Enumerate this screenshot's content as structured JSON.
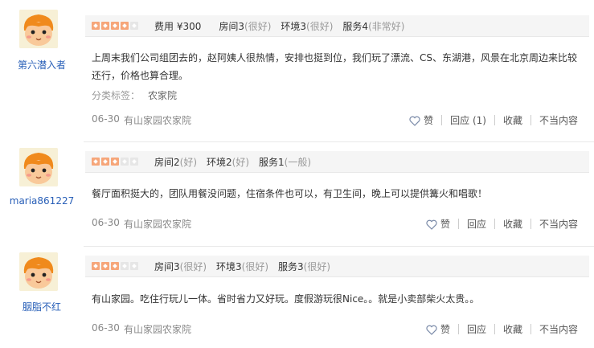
{
  "reviews": [
    {
      "username": "第六潜入者",
      "stars": 4,
      "price_label": "费用",
      "price_value": "¥300",
      "scores": [
        {
          "name": "房间3",
          "level": "(很好)"
        },
        {
          "name": "环境3",
          "level": "(很好)"
        },
        {
          "name": "服务4",
          "level": "(非常好)"
        }
      ],
      "content": "上周末我们公司组团去的，赵阿姨人很热情，安排也挺到位，我们玩了漂流、CS、东湖港，风景在北京周边来比较还行，价格也算合理。",
      "tags_label": "分类标签：",
      "tag": "农家院",
      "date": "06-30",
      "shop": "有山家园农家院",
      "like_label": "赞",
      "reply_label": "回应",
      "reply_count": "(1)",
      "collect_label": "收藏",
      "report_label": "不当内容"
    },
    {
      "username": "maria861227",
      "stars": 3,
      "scores": [
        {
          "name": "房间2",
          "level": "(好)"
        },
        {
          "name": "环境2",
          "level": "(好)"
        },
        {
          "name": "服务1",
          "level": "(一般)"
        }
      ],
      "content": "餐厅面积挺大的，团队用餐没问题，住宿条件也可以，有卫生间，晚上可以提供篝火和唱歌！",
      "date": "06-30",
      "shop": "有山家园农家院",
      "like_label": "赞",
      "reply_label": "回应",
      "collect_label": "收藏",
      "report_label": "不当内容"
    },
    {
      "username": "胭脂不红",
      "stars": 3,
      "scores": [
        {
          "name": "房间3",
          "level": "(很好)"
        },
        {
          "name": "环境3",
          "level": "(很好)"
        },
        {
          "name": "服务3",
          "level": "(很好)"
        }
      ],
      "content": "有山家园。吃住行玩儿一体。省时省力又好玩。度假游玩很Nice。。就是小卖部柴火太贵。。",
      "date": "06-30",
      "shop": "有山家园农家院",
      "like_label": "赞",
      "reply_label": "回应",
      "collect_label": "收藏",
      "report_label": "不当内容"
    }
  ],
  "colors": {
    "accent_link": "#2a60b8",
    "star_on": "#f6a67a",
    "star_off": "#e6e6e6"
  },
  "icons": {
    "like": "heart-outline-icon"
  }
}
